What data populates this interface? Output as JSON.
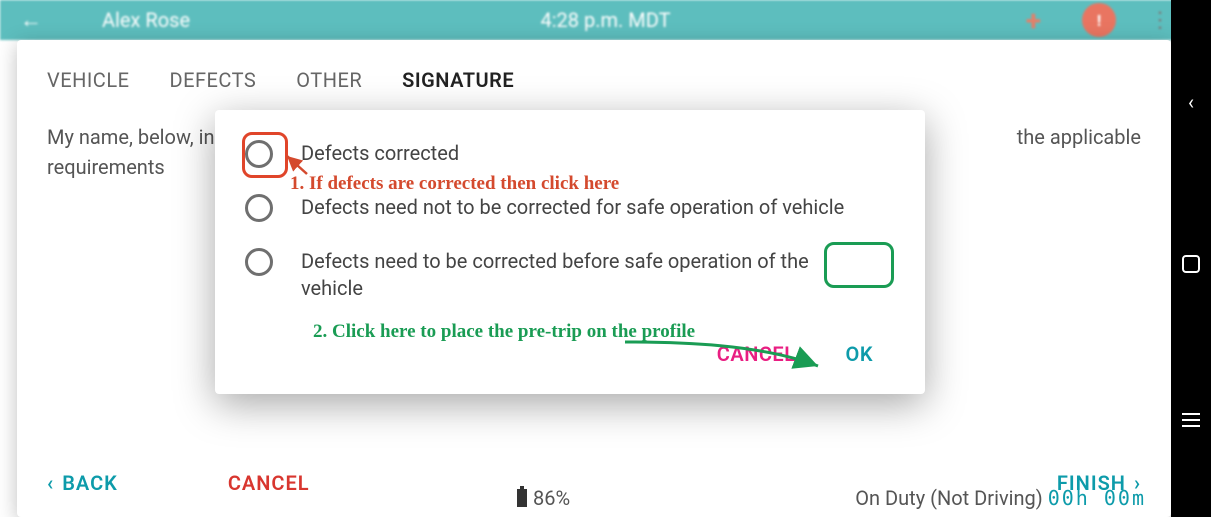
{
  "topbar": {
    "name": "Alex Rose",
    "time": "4:28 p.m. MDT"
  },
  "tabs": {
    "vehicle": "VEHICLE",
    "defects": "DEFECTS",
    "other": "OTHER",
    "signature": "SIGNATURE"
  },
  "intro_line1": "My name, below, in",
  "intro_line2": "requirements",
  "intro_right": "the applicable",
  "dialog": {
    "opt1": "Defects corrected",
    "opt2": "Defects need not to be corrected for safe operation of vehicle",
    "opt3": "Defects need to be corrected before safe operation of the vehicle",
    "cancel": "CANCEL",
    "ok": "OK"
  },
  "nav": {
    "back": "BACK",
    "cancel": "CANCEL",
    "finish": "FINISH"
  },
  "status": {
    "battery": "86%",
    "duty_label": "On Duty (Not Driving)",
    "duty_time": "00h  00m"
  },
  "annotations": {
    "a1": "1. If defects are corrected then click here",
    "a2": "2. Click here to place the pre-trip on the profile"
  }
}
